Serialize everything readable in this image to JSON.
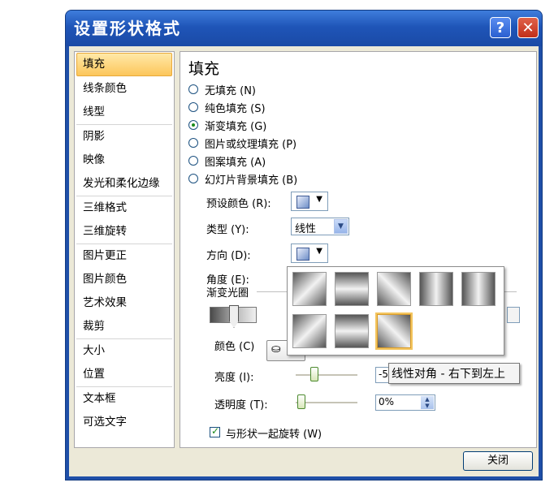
{
  "window": {
    "title": "设置形状格式",
    "help": "?",
    "close": "✕"
  },
  "nav": {
    "items": [
      {
        "label": "填充",
        "selected": true
      },
      {
        "label": "线条颜色"
      },
      {
        "label": "线型"
      },
      {
        "label": "阴影"
      },
      {
        "label": "映像"
      },
      {
        "label": "发光和柔化边缘"
      },
      {
        "label": "三维格式"
      },
      {
        "label": "三维旋转"
      },
      {
        "label": "图片更正"
      },
      {
        "label": "图片颜色"
      },
      {
        "label": "艺术效果"
      },
      {
        "label": "裁剪"
      },
      {
        "label": "大小"
      },
      {
        "label": "位置"
      },
      {
        "label": "文本框"
      },
      {
        "label": "可选文字"
      }
    ]
  },
  "fill": {
    "heading": "填充",
    "options": [
      {
        "label": "无填充 (N)",
        "checked": false
      },
      {
        "label": "纯色填充 (S)",
        "checked": false
      },
      {
        "label": "渐变填充 (G)",
        "checked": true
      },
      {
        "label": "图片或纹理填充 (P)",
        "checked": false
      },
      {
        "label": "图案填充 (A)",
        "checked": false
      },
      {
        "label": "幻灯片背景填充 (B)",
        "checked": false
      }
    ],
    "preset_label": "预设颜色 (R):",
    "type_label": "类型 (Y):",
    "type_value": "线性",
    "direction_label": "方向 (D):",
    "angle_label": "角度 (E):",
    "stops_label": "渐变光圈",
    "color_label": "颜色 (C)",
    "brightness_label": "亮度 (I):",
    "brightness_value": "-5",
    "transparency_label": "透明度 (T):",
    "transparency_value": "0%",
    "rotate_label": "与形状一起旋转 (W)",
    "rotate_checked": true
  },
  "tooltip": "线性对角 - 右下到左上",
  "footer": {
    "close_label": "关闭"
  }
}
